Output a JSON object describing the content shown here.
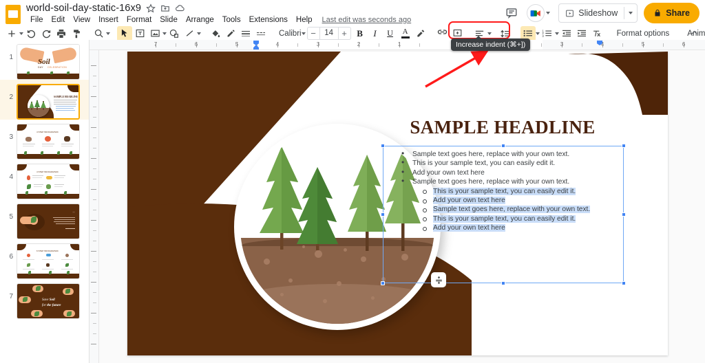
{
  "header": {
    "doc_title": "world-soil-day-static-16x9",
    "star_icon": "star-icon",
    "move_icon": "move-to-folder-icon",
    "cloud_icon": "cloud-saved-icon",
    "menus": [
      "File",
      "Edit",
      "View",
      "Insert",
      "Format",
      "Slide",
      "Arrange",
      "Tools",
      "Extensions",
      "Help"
    ],
    "last_edit": "Last edit was seconds ago",
    "comment_icon": "comment-history-icon",
    "meet_icon": "google-meet-icon",
    "slideshow_label": "Slideshow",
    "slideshow_icon": "present-play-icon",
    "share_label": "Share",
    "share_icon": "lock-icon",
    "accent_color": "#F9AB00"
  },
  "toolbar": {
    "new_slide": "add-slide-icon",
    "undo": "undo-icon",
    "redo": "redo-icon",
    "print": "print-icon",
    "paint_format": "paint-format-icon",
    "zoom": "zoom-icon",
    "select": "select-cursor-icon",
    "textbox": "text-box-icon",
    "image": "insert-image-icon",
    "shape": "shape-icon",
    "line": "line-icon",
    "fill_color": "fill-color-icon",
    "border_color": "border-color-icon",
    "border_weight": "border-weight-icon",
    "border_dash": "border-dash-icon",
    "font_name": "Calibri",
    "font_size": "14",
    "decrease_size": "−",
    "increase_size": "+",
    "bold": "B",
    "italic": "I",
    "underline": "U",
    "text_color": "A",
    "highlight_color": "highlight-color-icon",
    "link": "insert-link-icon",
    "comment": "add-comment-icon",
    "align": "align-icon",
    "line_spacing": "line-spacing-icon",
    "bulleted_list": "bulleted-list-icon",
    "numbered_list": "numbered-list-icon",
    "decrease_indent": "decrease-indent-icon",
    "increase_indent": "increase-indent-icon",
    "clear_formatting": "clear-formatting-icon",
    "format_options": "Format options",
    "animate": "Animate",
    "collapse": "collapse-toolbar-icon"
  },
  "tooltip": {
    "text": "Increase indent (⌘+])"
  },
  "annotation": {
    "highlight_color": "#ff1a1a",
    "target": "increase-indent-icon"
  },
  "ruler": {
    "labels_left": [
      "7",
      "6",
      "5",
      "4",
      "3",
      "2",
      "1"
    ],
    "labels_right": [
      "1",
      "2",
      "3",
      "4",
      "5",
      "6"
    ],
    "first_line_indent_marker": "first-line-indent-marker",
    "left_indent_marker": "left-indent-marker",
    "right_indent_marker": "right-indent-marker"
  },
  "filmstrip": {
    "slides": [
      {
        "num": "1",
        "selected": false,
        "name": "slide-thumbnail-1"
      },
      {
        "num": "2",
        "selected": true,
        "name": "slide-thumbnail-2"
      },
      {
        "num": "3",
        "selected": false,
        "name": "slide-thumbnail-3"
      },
      {
        "num": "4",
        "selected": false,
        "name": "slide-thumbnail-4"
      },
      {
        "num": "5",
        "selected": false,
        "name": "slide-thumbnail-5"
      },
      {
        "num": "6",
        "selected": false,
        "name": "slide-thumbnail-6"
      },
      {
        "num": "7",
        "selected": false,
        "name": "slide-thumbnail-7"
      }
    ]
  },
  "slide": {
    "headline": "SAMPLE HEADLINE",
    "brown_color": "#5A2D0C",
    "headline_color": "#4A2310",
    "selection_color": "#C9DDF8",
    "bullets_level1": [
      "Sample text goes here, replace with your own text.",
      "This is your sample text, you can easily edit it.",
      "Add your own text here",
      "Sample text goes here, replace with your own text."
    ],
    "bullets_level2": [
      "This is your sample text, you can easily edit it.",
      "Add your own text here",
      "Sample text goes here, replace with your own text.",
      "This is your sample text, you can easily edit it.",
      "Add your own text here"
    ],
    "line_spacing_fab": "line-spacing-floating-button"
  }
}
